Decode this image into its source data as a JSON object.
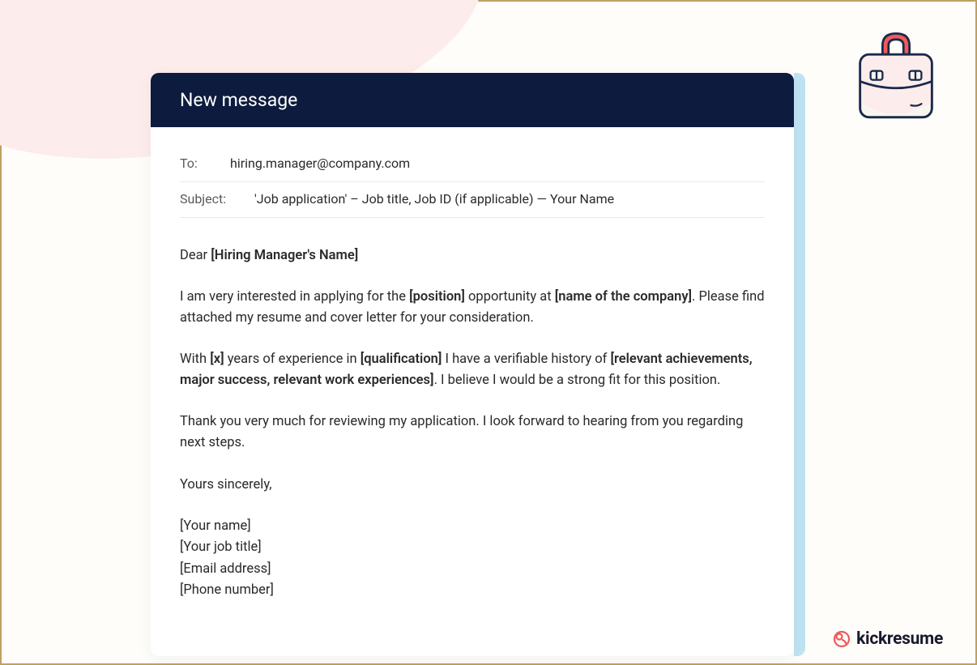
{
  "header": {
    "title": "New message"
  },
  "fields": {
    "to_label": "To:",
    "to_value": "hiring.manager@company.com",
    "subject_label": "Subject:",
    "subject_value": "'Job application' – Job title, Job ID (if applicable) — Your Name"
  },
  "body": {
    "greeting_prefix": "Dear ",
    "greeting_bold": "[Hiring Manager's Name]",
    "p1_a": "I am very interested in applying for the ",
    "p1_bold1": "[position]",
    "p1_b": " opportunity at ",
    "p1_bold2": "[name of the company]",
    "p1_c": ". Please find attached my resume and cover letter for your consideration.",
    "p2_a": "With ",
    "p2_bold1": "[x]",
    "p2_b": " years of experience in ",
    "p2_bold2": "[qualification]",
    "p2_c": " I have a verifiable history of ",
    "p2_bold3": "[relevant achievements, major success, relevant work experiences]",
    "p2_d": ". I believe I would be a strong fit for this position.",
    "p3": "Thank you very much for reviewing my application. I look forward to hearing from you regarding next steps.",
    "signoff": "Yours sincerely,",
    "sig_name": "[Your name]",
    "sig_title": "[Your job title]",
    "sig_email": "[Email address]",
    "sig_phone": "[Phone number]"
  },
  "brand": {
    "name": "kickresume"
  }
}
